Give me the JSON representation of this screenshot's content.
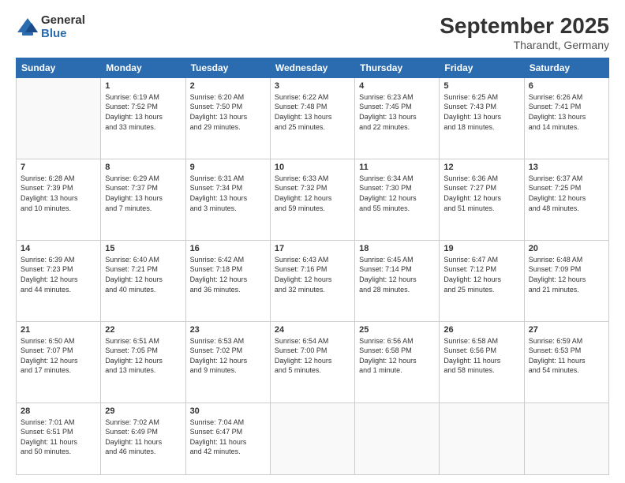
{
  "logo": {
    "general": "General",
    "blue": "Blue"
  },
  "header": {
    "month": "September 2025",
    "location": "Tharandt, Germany"
  },
  "weekdays": [
    "Sunday",
    "Monday",
    "Tuesday",
    "Wednesday",
    "Thursday",
    "Friday",
    "Saturday"
  ],
  "weeks": [
    [
      {
        "day": "",
        "info": ""
      },
      {
        "day": "1",
        "info": "Sunrise: 6:19 AM\nSunset: 7:52 PM\nDaylight: 13 hours\nand 33 minutes."
      },
      {
        "day": "2",
        "info": "Sunrise: 6:20 AM\nSunset: 7:50 PM\nDaylight: 13 hours\nand 29 minutes."
      },
      {
        "day": "3",
        "info": "Sunrise: 6:22 AM\nSunset: 7:48 PM\nDaylight: 13 hours\nand 25 minutes."
      },
      {
        "day": "4",
        "info": "Sunrise: 6:23 AM\nSunset: 7:45 PM\nDaylight: 13 hours\nand 22 minutes."
      },
      {
        "day": "5",
        "info": "Sunrise: 6:25 AM\nSunset: 7:43 PM\nDaylight: 13 hours\nand 18 minutes."
      },
      {
        "day": "6",
        "info": "Sunrise: 6:26 AM\nSunset: 7:41 PM\nDaylight: 13 hours\nand 14 minutes."
      }
    ],
    [
      {
        "day": "7",
        "info": "Sunrise: 6:28 AM\nSunset: 7:39 PM\nDaylight: 13 hours\nand 10 minutes."
      },
      {
        "day": "8",
        "info": "Sunrise: 6:29 AM\nSunset: 7:37 PM\nDaylight: 13 hours\nand 7 minutes."
      },
      {
        "day": "9",
        "info": "Sunrise: 6:31 AM\nSunset: 7:34 PM\nDaylight: 13 hours\nand 3 minutes."
      },
      {
        "day": "10",
        "info": "Sunrise: 6:33 AM\nSunset: 7:32 PM\nDaylight: 12 hours\nand 59 minutes."
      },
      {
        "day": "11",
        "info": "Sunrise: 6:34 AM\nSunset: 7:30 PM\nDaylight: 12 hours\nand 55 minutes."
      },
      {
        "day": "12",
        "info": "Sunrise: 6:36 AM\nSunset: 7:27 PM\nDaylight: 12 hours\nand 51 minutes."
      },
      {
        "day": "13",
        "info": "Sunrise: 6:37 AM\nSunset: 7:25 PM\nDaylight: 12 hours\nand 48 minutes."
      }
    ],
    [
      {
        "day": "14",
        "info": "Sunrise: 6:39 AM\nSunset: 7:23 PM\nDaylight: 12 hours\nand 44 minutes."
      },
      {
        "day": "15",
        "info": "Sunrise: 6:40 AM\nSunset: 7:21 PM\nDaylight: 12 hours\nand 40 minutes."
      },
      {
        "day": "16",
        "info": "Sunrise: 6:42 AM\nSunset: 7:18 PM\nDaylight: 12 hours\nand 36 minutes."
      },
      {
        "day": "17",
        "info": "Sunrise: 6:43 AM\nSunset: 7:16 PM\nDaylight: 12 hours\nand 32 minutes."
      },
      {
        "day": "18",
        "info": "Sunrise: 6:45 AM\nSunset: 7:14 PM\nDaylight: 12 hours\nand 28 minutes."
      },
      {
        "day": "19",
        "info": "Sunrise: 6:47 AM\nSunset: 7:12 PM\nDaylight: 12 hours\nand 25 minutes."
      },
      {
        "day": "20",
        "info": "Sunrise: 6:48 AM\nSunset: 7:09 PM\nDaylight: 12 hours\nand 21 minutes."
      }
    ],
    [
      {
        "day": "21",
        "info": "Sunrise: 6:50 AM\nSunset: 7:07 PM\nDaylight: 12 hours\nand 17 minutes."
      },
      {
        "day": "22",
        "info": "Sunrise: 6:51 AM\nSunset: 7:05 PM\nDaylight: 12 hours\nand 13 minutes."
      },
      {
        "day": "23",
        "info": "Sunrise: 6:53 AM\nSunset: 7:02 PM\nDaylight: 12 hours\nand 9 minutes."
      },
      {
        "day": "24",
        "info": "Sunrise: 6:54 AM\nSunset: 7:00 PM\nDaylight: 12 hours\nand 5 minutes."
      },
      {
        "day": "25",
        "info": "Sunrise: 6:56 AM\nSunset: 6:58 PM\nDaylight: 12 hours\nand 1 minute."
      },
      {
        "day": "26",
        "info": "Sunrise: 6:58 AM\nSunset: 6:56 PM\nDaylight: 11 hours\nand 58 minutes."
      },
      {
        "day": "27",
        "info": "Sunrise: 6:59 AM\nSunset: 6:53 PM\nDaylight: 11 hours\nand 54 minutes."
      }
    ],
    [
      {
        "day": "28",
        "info": "Sunrise: 7:01 AM\nSunset: 6:51 PM\nDaylight: 11 hours\nand 50 minutes."
      },
      {
        "day": "29",
        "info": "Sunrise: 7:02 AM\nSunset: 6:49 PM\nDaylight: 11 hours\nand 46 minutes."
      },
      {
        "day": "30",
        "info": "Sunrise: 7:04 AM\nSunset: 6:47 PM\nDaylight: 11 hours\nand 42 minutes."
      },
      {
        "day": "",
        "info": ""
      },
      {
        "day": "",
        "info": ""
      },
      {
        "day": "",
        "info": ""
      },
      {
        "day": "",
        "info": ""
      }
    ]
  ]
}
